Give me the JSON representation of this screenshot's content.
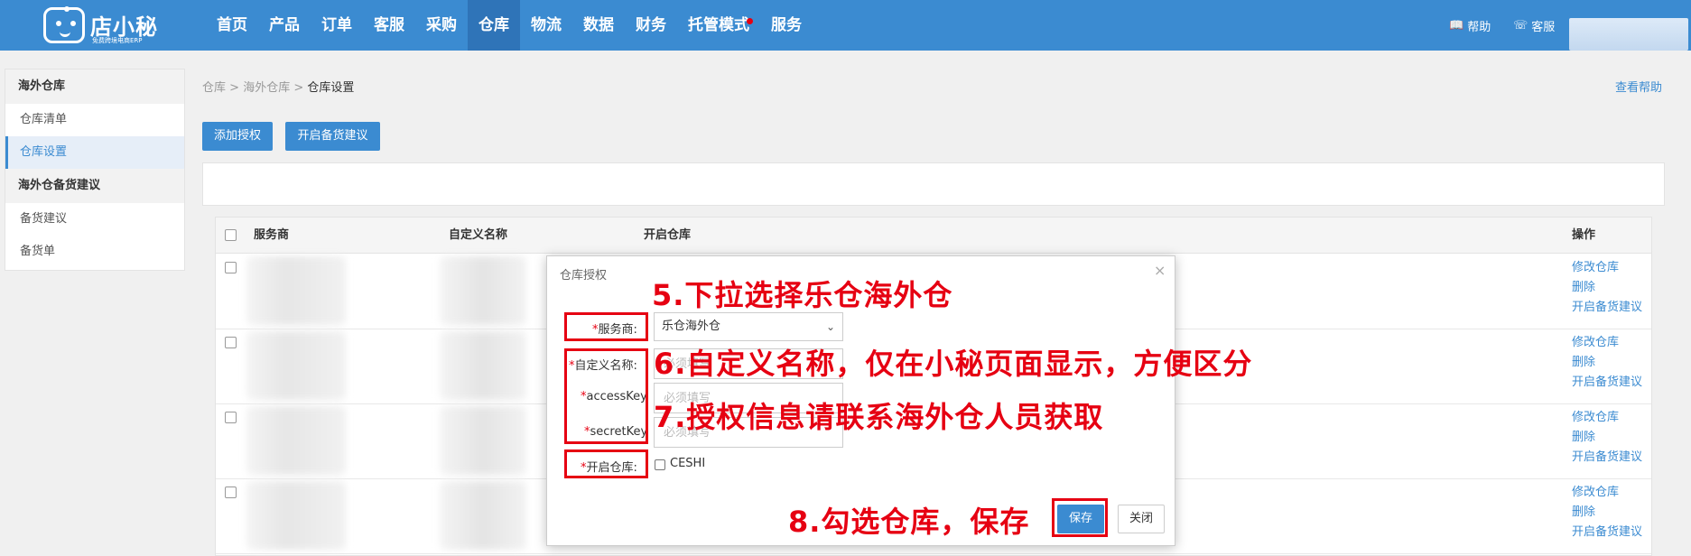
{
  "app": {
    "logo_name": "店小秘",
    "logo_tagline": "免费跨境电商ERP",
    "nav": [
      "首页",
      "产品",
      "订单",
      "客服",
      "采购",
      "仓库",
      "物流",
      "数据",
      "财务",
      "托管模式",
      "服务"
    ],
    "active_nav": "仓库",
    "help_label": "帮助",
    "service_label": "客服"
  },
  "sidebar": {
    "groups": [
      {
        "title": "海外仓库",
        "items": [
          "仓库清单",
          "仓库设置"
        ]
      },
      {
        "title": "海外仓备货建议",
        "items": [
          "备货建议",
          "备货单"
        ]
      }
    ],
    "active_item": "仓库设置"
  },
  "breadcrumb": [
    "仓库",
    "海外仓库",
    "仓库设置"
  ],
  "view_help": "查看帮助",
  "buttons": {
    "add_auth": "添加授权",
    "stock_plan": "开启备货建议"
  },
  "table": {
    "columns": [
      "服务商",
      "自定义名称",
      "开启仓库",
      "操作"
    ],
    "row_actions": [
      "修改仓库",
      "删除",
      "开启备货建议"
    ],
    "row_count": 4
  },
  "modal": {
    "title": "仓库授权",
    "close": "×",
    "fields": {
      "provider": {
        "required": "*",
        "label": "服务商:",
        "value": "乐仓海外仓"
      },
      "custom_name": {
        "required": "*",
        "label": "自定义名称:",
        "placeholder": "必须填写"
      },
      "access_key": {
        "required": "*",
        "label": "accessKey",
        "placeholder": "必须填写"
      },
      "secret_key": {
        "required": "*",
        "label": "secretKey",
        "placeholder": "必须填写"
      },
      "enable_warehouse": {
        "required": "*",
        "label": "开启仓库:",
        "option": "CESHI"
      }
    },
    "save": "保存",
    "close_button": "关闭"
  },
  "annotations": {
    "step5": "5.下拉选择乐仓海外仓",
    "step6": "6.自定义名称，仅在小秘页面显示，方便区分",
    "step7": "7.授权信息请联系海外仓人员获取",
    "step8": "8.勾选仓库，保存",
    "color": "#e60012"
  },
  "colors": {
    "brand": "#3b8bd1",
    "nav_active": "#2f74b8",
    "notice_dot": "#e60012"
  }
}
